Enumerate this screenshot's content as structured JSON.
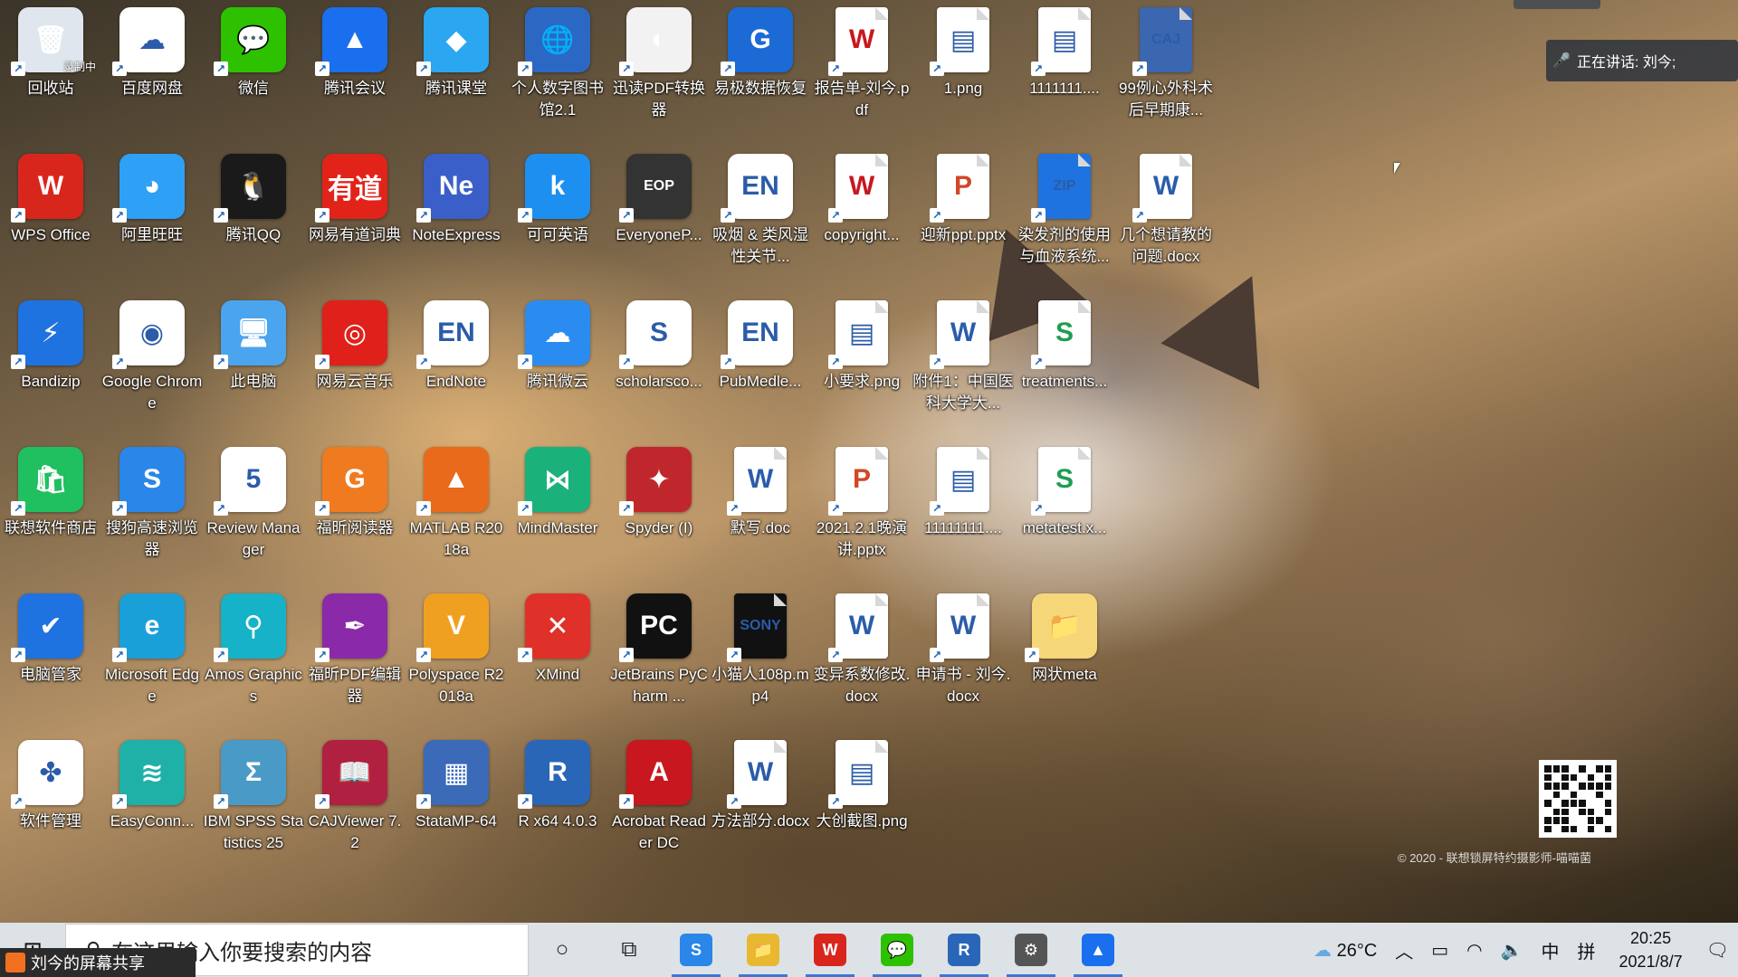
{
  "desktop": {
    "icons": [
      {
        "label": "回收站",
        "icon": "recycle-bin-icon",
        "color": "#dfe6ee",
        "glyph": "🗑",
        "overlay": "录制中"
      },
      {
        "label": "百度网盘",
        "icon": "baidu-netdisk-icon",
        "color": "#ffffff",
        "glyph": "☁"
      },
      {
        "label": "微信",
        "icon": "wechat-icon",
        "color": "#2dc100",
        "glyph": "💬"
      },
      {
        "label": "腾讯会议",
        "icon": "tencent-meeting-icon",
        "color": "#1a6fee",
        "glyph": "▲"
      },
      {
        "label": "腾讯课堂",
        "icon": "tencent-classroom-icon",
        "color": "#2aa7f0",
        "glyph": "◆"
      },
      {
        "label": "个人数字图书馆2.1",
        "icon": "digital-library-icon",
        "color": "#2b68c4",
        "glyph": "🌐"
      },
      {
        "label": "迅读PDF转换器",
        "icon": "pdf-converter-icon",
        "color": "#f2f2f2",
        "glyph": "◐"
      },
      {
        "label": "易极数据恢复",
        "icon": "data-recovery-icon",
        "color": "#1c6ad6",
        "glyph": "G"
      },
      {
        "label": "报告单-刘今.pdf",
        "icon": "pdf-file-icon",
        "color": "#ffffff",
        "glyph": "W"
      },
      {
        "label": "1.png",
        "icon": "png-file-icon",
        "color": "#ffffff",
        "glyph": "▤"
      },
      {
        "label": "1111111....",
        "icon": "image-file-icon",
        "color": "#ffffff",
        "glyph": "▤"
      },
      {
        "label": "99例心外科术后早期康...",
        "icon": "caj-file-icon",
        "color": "#3b66b0",
        "glyph": "CAJ"
      },
      {
        "label": "WPS Office",
        "icon": "wps-office-icon",
        "color": "#d9261c",
        "glyph": "W"
      },
      {
        "label": "阿里旺旺",
        "icon": "aliwangwang-icon",
        "color": "#2ea0f5",
        "glyph": "◕"
      },
      {
        "label": "腾讯QQ",
        "icon": "qq-icon",
        "color": "#1a1a1a",
        "glyph": "🐧"
      },
      {
        "label": "网易有道词典",
        "icon": "youdao-dict-icon",
        "color": "#e2231a",
        "glyph": "有道"
      },
      {
        "label": "NoteExpress",
        "icon": "noteexpress-icon",
        "color": "#3b5fc8",
        "glyph": "Ne"
      },
      {
        "label": "可可英语",
        "icon": "keke-english-icon",
        "color": "#1d8ff0",
        "glyph": "k"
      },
      {
        "label": "EveryoneP...",
        "icon": "everyone-piano-icon",
        "color": "#333333",
        "glyph": "EOP"
      },
      {
        "label": "吸烟 & 类风湿性关节...",
        "icon": "endnote-library-icon",
        "color": "#ffffff",
        "glyph": "EN"
      },
      {
        "label": "copyright...",
        "icon": "pdf-file-icon",
        "color": "#ffffff",
        "glyph": "W"
      },
      {
        "label": "迎新ppt.pptx",
        "icon": "pptx-file-icon",
        "color": "#ffffff",
        "glyph": "P"
      },
      {
        "label": "染发剂的使用与血液系统...",
        "icon": "zip-file-icon",
        "color": "#1f73e0",
        "glyph": "ZIP"
      },
      {
        "label": "几个想请教的问题.docx",
        "icon": "docx-file-icon",
        "color": "#ffffff",
        "glyph": "W"
      },
      {
        "label": "Bandizip",
        "icon": "bandizip-icon",
        "color": "#1f73e0",
        "glyph": "⚡"
      },
      {
        "label": "Google Chrome",
        "icon": "chrome-icon",
        "color": "#ffffff",
        "glyph": "◉"
      },
      {
        "label": "此电脑",
        "icon": "this-pc-icon",
        "color": "#4aa4ee",
        "glyph": "🖥"
      },
      {
        "label": "网易云音乐",
        "icon": "netease-music-icon",
        "color": "#e0201a",
        "glyph": "◎"
      },
      {
        "label": "EndNote",
        "icon": "endnote-icon",
        "color": "#ffffff",
        "glyph": "EN"
      },
      {
        "label": "腾讯微云",
        "icon": "weiyun-icon",
        "color": "#2a8cf0",
        "glyph": "☁"
      },
      {
        "label": "scholarsco...",
        "icon": "scholarscope-icon",
        "color": "#ffffff",
        "glyph": "S"
      },
      {
        "label": "PubMedle...",
        "icon": "endnote-library-icon",
        "color": "#ffffff",
        "glyph": "EN"
      },
      {
        "label": "小要求.png",
        "icon": "png-file-icon",
        "color": "#ffffff",
        "glyph": "▤"
      },
      {
        "label": "附件1：中国医科大学大...",
        "icon": "docx-file-icon",
        "color": "#ffffff",
        "glyph": "W"
      },
      {
        "label": "treatments...",
        "icon": "xlsx-file-icon",
        "color": "#ffffff",
        "glyph": "S"
      },
      {
        "label": "联想软件商店",
        "icon": "lenovo-store-icon",
        "color": "#20c060",
        "glyph": "🛍"
      },
      {
        "label": "搜狗高速浏览器",
        "icon": "sogou-browser-icon",
        "color": "#2a86e8",
        "glyph": "S"
      },
      {
        "label": "Review Manager",
        "icon": "review-manager-icon",
        "color": "#ffffff",
        "glyph": "5"
      },
      {
        "label": "福昕阅读器",
        "icon": "foxit-reader-icon",
        "color": "#f07a20",
        "glyph": "G"
      },
      {
        "label": "MATLAB R2018a",
        "icon": "matlab-icon",
        "color": "#e86a1a",
        "glyph": "▲"
      },
      {
        "label": "MindMaster",
        "icon": "mindmaster-icon",
        "color": "#1ab27a",
        "glyph": "⋈"
      },
      {
        "label": "Spyder (I)",
        "icon": "spyder-icon",
        "color": "#c0272d",
        "glyph": "✦"
      },
      {
        "label": "默写.doc",
        "icon": "doc-file-icon",
        "color": "#ffffff",
        "glyph": "W"
      },
      {
        "label": "2021.2.1晚演讲.pptx",
        "icon": "pptx-file-icon",
        "color": "#ffffff",
        "glyph": "P"
      },
      {
        "label": "11111111....",
        "icon": "image-file-icon",
        "color": "#ffffff",
        "glyph": "▤"
      },
      {
        "label": "metatest.x...",
        "icon": "xlsx-file-icon",
        "color": "#ffffff",
        "glyph": "S"
      },
      {
        "label": "电脑管家",
        "icon": "pc-manager-icon",
        "color": "#1f73e0",
        "glyph": "✔"
      },
      {
        "label": "Microsoft Edge",
        "icon": "edge-icon",
        "color": "#1aa0d8",
        "glyph": "e"
      },
      {
        "label": "Amos Graphics",
        "icon": "amos-icon",
        "color": "#16b2c8",
        "glyph": "⚲"
      },
      {
        "label": "福昕PDF编辑器",
        "icon": "foxit-editor-icon",
        "color": "#8a2aa8",
        "glyph": "✒"
      },
      {
        "label": "Polyspace R2018a",
        "icon": "polyspace-icon",
        "color": "#f0a020",
        "glyph": "V"
      },
      {
        "label": "XMind",
        "icon": "xmind-icon",
        "color": "#e0302a",
        "glyph": "✕"
      },
      {
        "label": "JetBrains PyCharm ...",
        "icon": "pycharm-icon",
        "color": "#111111",
        "glyph": "PC"
      },
      {
        "label": "小猫人108p.mp4",
        "icon": "video-file-icon",
        "color": "#111111",
        "glyph": "SONY"
      },
      {
        "label": "变异系数修改.docx",
        "icon": "docx-file-icon",
        "color": "#ffffff",
        "glyph": "W"
      },
      {
        "label": "申请书 - 刘今.docx",
        "icon": "docx-file-icon",
        "color": "#ffffff",
        "glyph": "W"
      },
      {
        "label": "网状meta",
        "icon": "folder-icon",
        "color": "#f5d77a",
        "glyph": "📁"
      },
      {
        "label": "软件管理",
        "icon": "software-manager-icon",
        "color": "#ffffff",
        "glyph": "✤"
      },
      {
        "label": "EasyConn...",
        "icon": "easyconnect-icon",
        "color": "#1fb0a8",
        "glyph": "≋"
      },
      {
        "label": "IBM SPSS Statistics 25",
        "icon": "spss-icon",
        "color": "#4a9ac8",
        "glyph": "Σ"
      },
      {
        "label": "CAJViewer 7.2",
        "icon": "cajviewer-icon",
        "color": "#b02040",
        "glyph": "📖"
      },
      {
        "label": "StataMP-64",
        "icon": "stata-icon",
        "color": "#3a6ab8",
        "glyph": "▦"
      },
      {
        "label": "R x64 4.0.3",
        "icon": "r-language-icon",
        "color": "#2a66b8",
        "glyph": "R"
      },
      {
        "label": "Acrobat Reader DC",
        "icon": "acrobat-icon",
        "color": "#c8171e",
        "glyph": "A"
      },
      {
        "label": "方法部分.docx",
        "icon": "docx-file-icon",
        "color": "#ffffff",
        "glyph": "W"
      },
      {
        "label": "大创截图.png",
        "icon": "png-file-icon",
        "color": "#ffffff",
        "glyph": "▤"
      }
    ]
  },
  "meeting": {
    "speaking_label": "正在讲话: 刘今;"
  },
  "watermark": {
    "copyright": "© 2020 - 联想锁屏特约摄影师-喵喵菌"
  },
  "taskbar": {
    "search_placeholder": "在这里输入你要搜索的内容",
    "share_label": "刘今的屏幕共享",
    "apps": [
      {
        "name": "sogou-browser",
        "glyph": "S",
        "color": "#2a86e8"
      },
      {
        "name": "file-explorer",
        "glyph": "📁",
        "color": "#e8b830"
      },
      {
        "name": "wps-office",
        "glyph": "W",
        "color": "#d9261c"
      },
      {
        "name": "wechat",
        "glyph": "💬",
        "color": "#2dc100"
      },
      {
        "name": "r-language",
        "glyph": "R",
        "color": "#2a66b8"
      },
      {
        "name": "settings",
        "glyph": "⚙",
        "color": "#555555"
      },
      {
        "name": "tencent-meeting",
        "glyph": "▲",
        "color": "#1a6fee"
      }
    ],
    "weather_temp": "26°C",
    "ime_lang": "中",
    "ime_mode": "拼",
    "time": "20:25",
    "date": "2021/8/7"
  }
}
